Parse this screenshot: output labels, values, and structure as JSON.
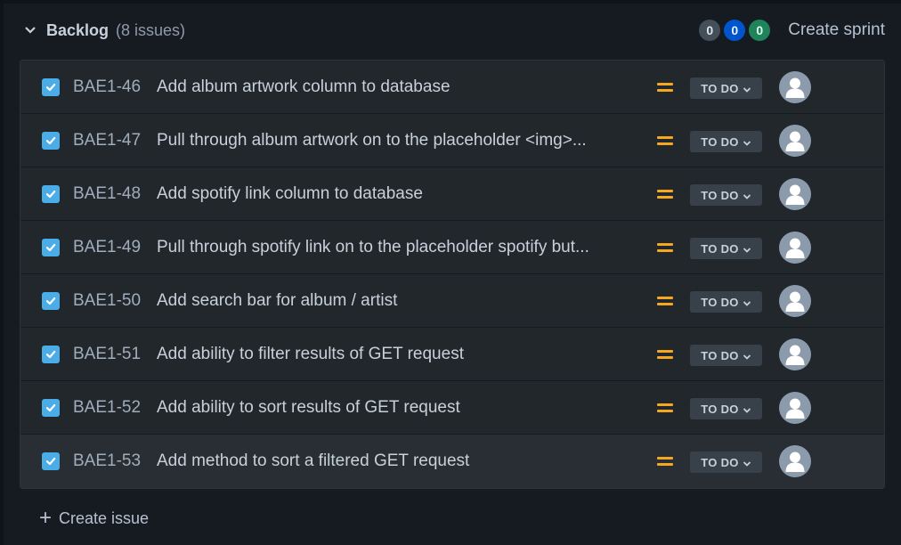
{
  "backlog": {
    "title": "Backlog",
    "count": "(8 issues)",
    "status_counts": {
      "todo": "0",
      "in_progress": "0",
      "done": "0"
    },
    "create_sprint_label": "Create sprint",
    "create_issue_label": "Create issue"
  },
  "issues": [
    {
      "key": "BAE1-46",
      "summary": "Add album artwork column to database",
      "status": "TO DO"
    },
    {
      "key": "BAE1-47",
      "summary": "Pull through album artwork on to the placeholder <img>...",
      "status": "TO DO"
    },
    {
      "key": "BAE1-48",
      "summary": "Add spotify link column to database",
      "status": "TO DO"
    },
    {
      "key": "BAE1-49",
      "summary": "Pull through spotify link on to the placeholder spotify but...",
      "status": "TO DO"
    },
    {
      "key": "BAE1-50",
      "summary": "Add search bar for album / artist",
      "status": "TO DO"
    },
    {
      "key": "BAE1-51",
      "summary": "Add ability to filter results of GET request",
      "status": "TO DO"
    },
    {
      "key": "BAE1-52",
      "summary": "Add ability to sort results of GET request",
      "status": "TO DO"
    },
    {
      "key": "BAE1-53",
      "summary": "Add method to sort a filtered GET request",
      "status": "TO DO"
    }
  ],
  "colors": {
    "accent_check": "#4bade8",
    "priority_medium": "#f5a623",
    "pill_in_progress": "#0055cc",
    "pill_done": "#1f845a"
  },
  "icons": {
    "collapse": "chevron-down-icon",
    "issue_type": "checkbox-task-icon",
    "priority": "priority-medium-icon",
    "assignee": "avatar-placeholder-icon",
    "add": "plus-icon"
  }
}
